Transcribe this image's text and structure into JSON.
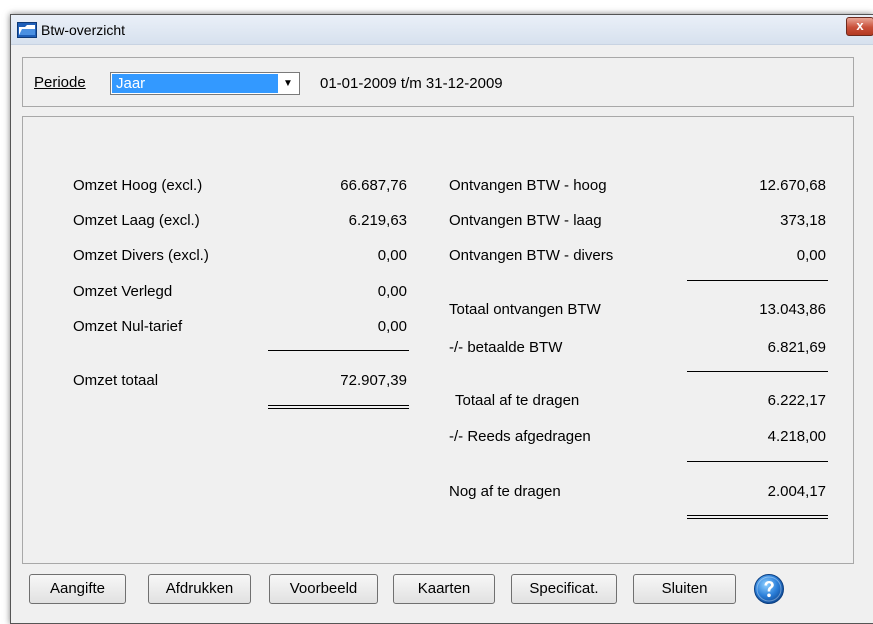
{
  "window": {
    "title": "Btw-overzicht",
    "close_label": "x"
  },
  "periode": {
    "label": "Periode",
    "selected": "Jaar",
    "range": "01-01-2009  t/m  31-12-2009"
  },
  "omzet": {
    "rows": [
      {
        "label": "Omzet Hoog (excl.)",
        "value": "66.687,76"
      },
      {
        "label": "Omzet Laag (excl.)",
        "value": "6.219,63"
      },
      {
        "label": "Omzet Divers (excl.)",
        "value": "0,00"
      },
      {
        "label": "Omzet Verlegd",
        "value": "0,00"
      },
      {
        "label": "Omzet Nul-tarief",
        "value": "0,00"
      }
    ],
    "total_label": "Omzet totaal",
    "total_value": "72.907,39"
  },
  "btw": {
    "rows": [
      {
        "label": "Ontvangen BTW - hoog",
        "value": "12.670,68"
      },
      {
        "label": "Ontvangen BTW - laag",
        "value": "373,18"
      },
      {
        "label": "Ontvangen BTW - divers",
        "value": "0,00"
      }
    ],
    "totaal_ontvangen_label": "Totaal ontvangen BTW",
    "totaal_ontvangen_value": "13.043,86",
    "betaalde_label": "-/- betaalde BTW",
    "betaalde_value": "6.821,69",
    "af_te_dragen_label": "Totaal af te dragen",
    "af_te_dragen_value": "6.222,17",
    "reeds_label": "-/- Reeds afgedragen",
    "reeds_value": "4.218,00",
    "nog_label": "Nog af te dragen",
    "nog_value": "2.004,17"
  },
  "buttons": {
    "aangifte": "Aangifte",
    "afdrukken": "Afdrukken",
    "voorbeeld": "Voorbeeld",
    "kaarten": "Kaarten",
    "specificat": "Specificat.",
    "sluiten": "Sluiten"
  },
  "colors": {
    "selection": "#3399ff",
    "close_button": "#c9503a",
    "help_icon": "#2b7fd9"
  }
}
